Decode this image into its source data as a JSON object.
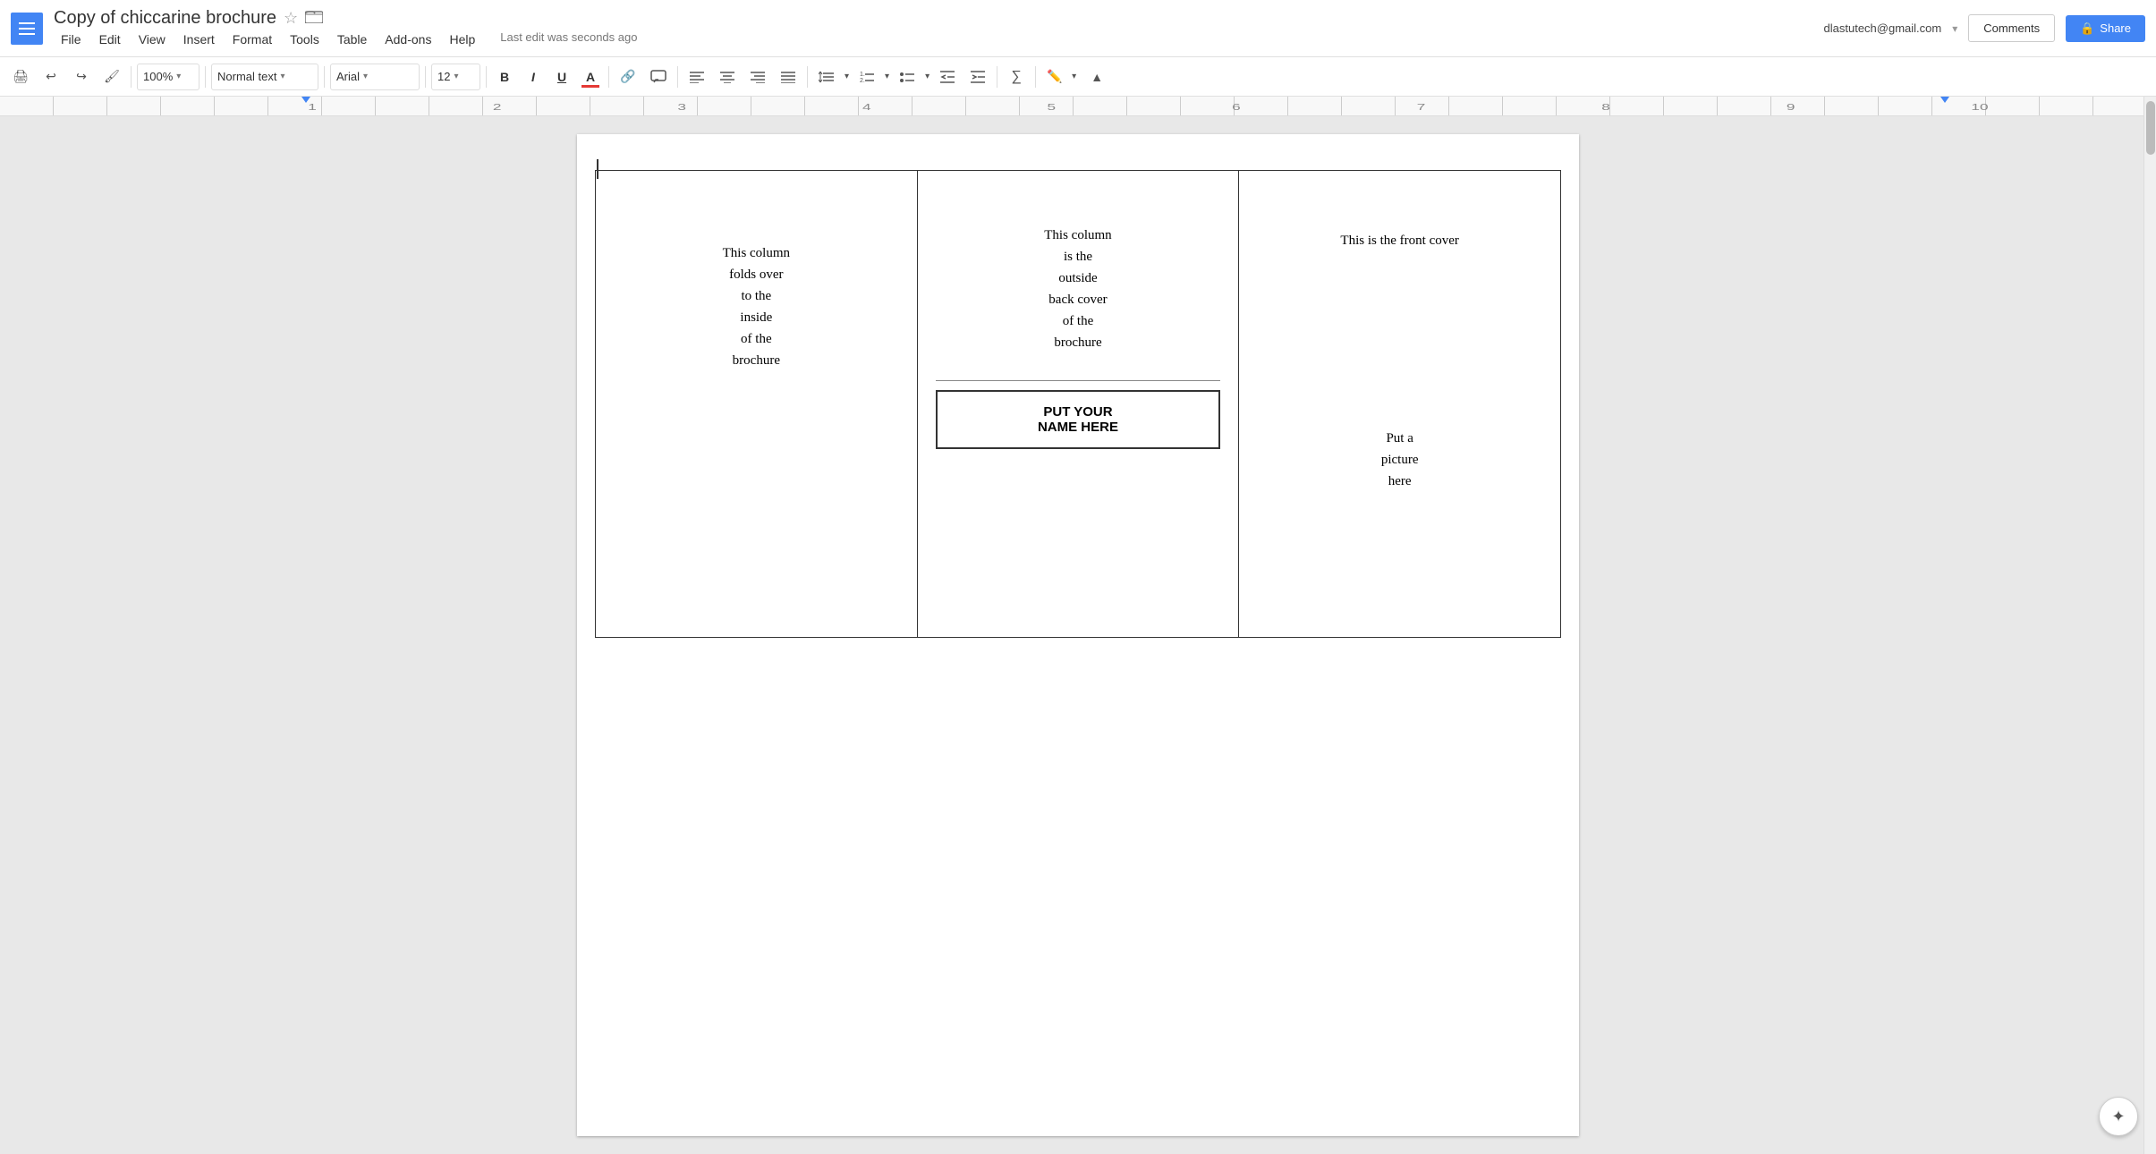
{
  "app": {
    "menu_icon_label": "☰",
    "title": "Copy of chiccarine brochure",
    "star": "☆",
    "folder": "▣"
  },
  "menu": {
    "items": [
      "File",
      "Edit",
      "View",
      "Insert",
      "Format",
      "Tools",
      "Table",
      "Add-ons",
      "Help"
    ]
  },
  "status": {
    "last_edit": "Last edit was seconds ago"
  },
  "header": {
    "user_email": "dlastutech@gmail.com",
    "comments_label": "Comments",
    "share_label": "Share",
    "share_icon": "🔒"
  },
  "toolbar": {
    "zoom": "100%",
    "style": "Normal text",
    "font": "Arial",
    "size": "12",
    "print_icon": "🖨",
    "undo_icon": "↩",
    "redo_icon": "↪",
    "paint_icon": "🖌",
    "bold_label": "B",
    "italic_label": "I",
    "underline_label": "U",
    "text_color_label": "A",
    "link_icon": "🔗",
    "comment_icon": "💬",
    "align_left": "≡",
    "align_center": "≡",
    "align_right": "≡",
    "align_justify": "≡",
    "line_spacing": "↕",
    "num_list": "1.",
    "bullet_list": "•",
    "indent_less": "⇤",
    "indent_more": "⇥",
    "formula": "∑",
    "pen_tool": "✏",
    "collapse": "▲"
  },
  "document": {
    "col1_text": "This column\nfolds over\nto the\ninside\nof the\nbrochure",
    "col2_text": "This column\nis the\noutside\nback cover\nof the\nbrochure",
    "name_box_line1": "PUT YOUR",
    "name_box_line2": "NAME HERE",
    "col3_top_text": "This is the front cover",
    "col3_bottom_text": "Put a\npicture\nhere"
  }
}
